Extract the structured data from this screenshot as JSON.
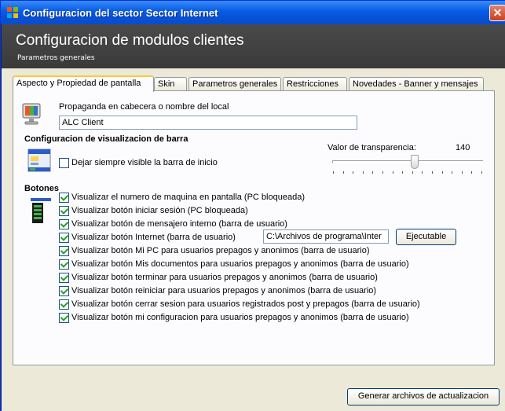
{
  "window": {
    "title": "Configuracion del sector Sector Internet",
    "close_glyph": "✕"
  },
  "header": {
    "title": "Configuracion de modulos clientes",
    "subtitle": "Parametros generales"
  },
  "tabs": [
    {
      "label": "Aspecto y Propiedad de pantalla",
      "active": true
    },
    {
      "label": "Skin",
      "active": false
    },
    {
      "label": "Parametros generales",
      "active": false
    },
    {
      "label": "Restricciones",
      "active": false
    },
    {
      "label": "Novedades - Banner y mensajes",
      "active": false
    }
  ],
  "propaganda": {
    "label": "Propaganda en cabecera o nombre del local",
    "value": "ALC Client",
    "icon": "monitor-icon"
  },
  "barra": {
    "heading": "Configuracion de visualizacion de barra",
    "icon": "window-taskbar-icon",
    "checkbox_label": "Dejar siempre visible la barra de inicio",
    "checked": false,
    "transparency_label": "Valor de transparencia:",
    "transparency_value": "140",
    "transparency_fraction": 0.55
  },
  "botones": {
    "heading": "Botones",
    "icon": "button-bar-icon",
    "items": [
      {
        "label": "Visualizar el numero de maquina en pantalla (PC bloqueada)",
        "checked": true
      },
      {
        "label": "Visualizar botón iniciar sesión (PC bloqueada)",
        "checked": true
      },
      {
        "label": "Visualizar botón de mensajero interno (barra de usuario)",
        "checked": true
      },
      {
        "label": "Visualizar botón Internet (barra de usuario)",
        "checked": true
      },
      {
        "label": "Visualizar botón Mi PC para usuarios prepagos y anonimos (barra de usuario)",
        "checked": true
      },
      {
        "label": "Visualizar botón Mis documentos para usuarios prepagos y anonimos (barra de usuario)",
        "checked": true
      },
      {
        "label": "Visualizar botón terminar para usuarios prepagos y anonimos (barra de usuario)",
        "checked": true
      },
      {
        "label": "Visualizar botón reiniciar para usuarios prepagos y anonimos (barra de usuario)",
        "checked": true
      },
      {
        "label": "Visualizar botón cerrar sesion para usuarios registrados post y prepagos (barra de usuario)",
        "checked": true
      },
      {
        "label": "Visualizar botón mi configuracion para usuarios prepagos y anonimos (barra de usuario)",
        "checked": true
      }
    ],
    "internet_path": "C:\\Archivos de programa\\Inter",
    "ejecutable_label": "Ejecutable"
  },
  "footer": {
    "generate_label": "Generar archivos de actualizacion"
  }
}
